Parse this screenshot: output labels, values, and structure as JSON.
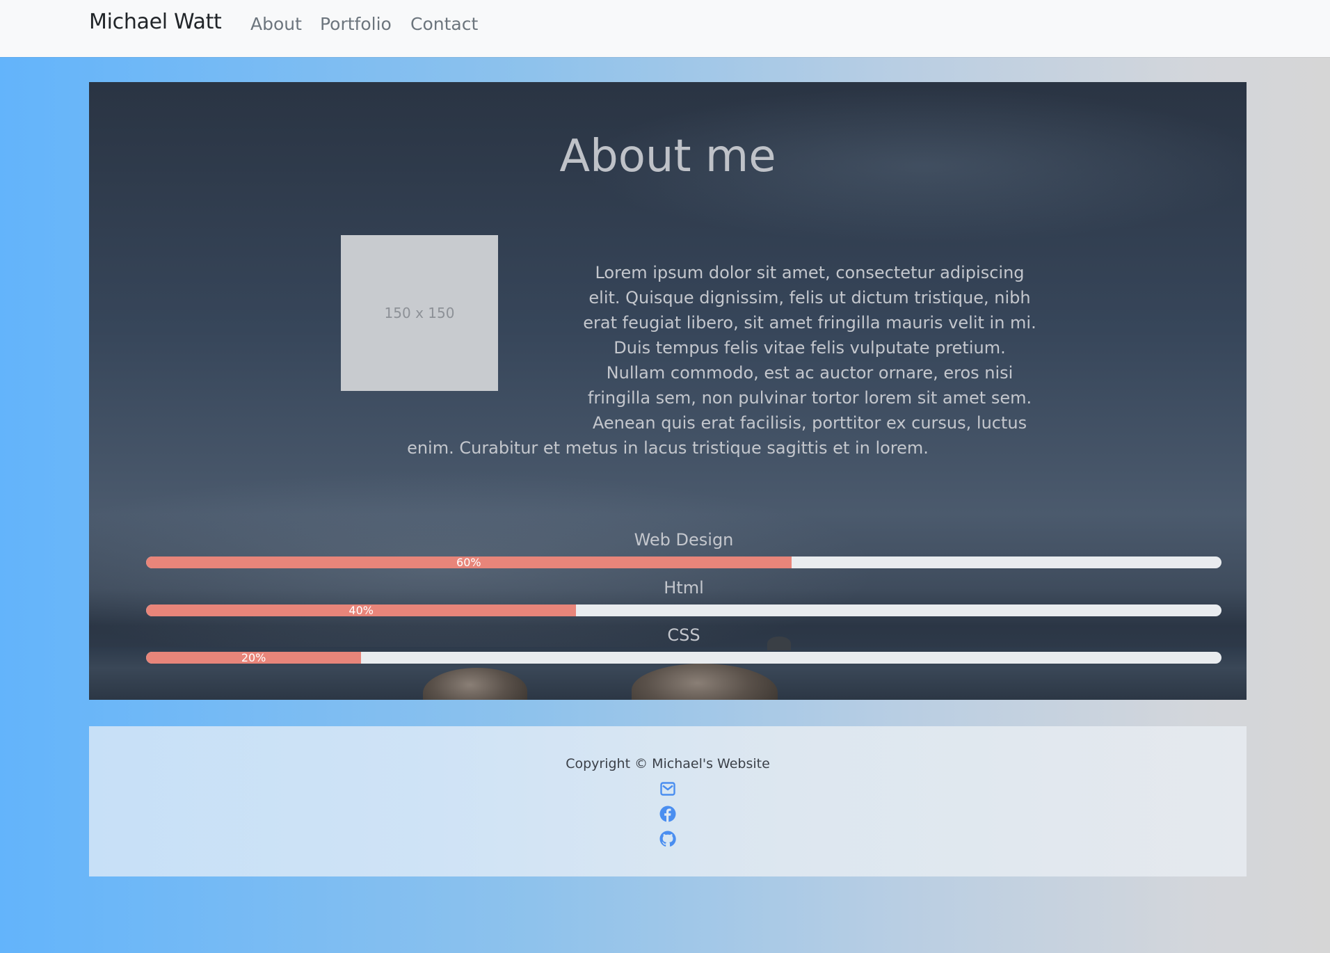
{
  "navbar": {
    "brand": "Michael Watt",
    "links": [
      {
        "label": "About"
      },
      {
        "label": "Portfolio"
      },
      {
        "label": "Contact"
      }
    ]
  },
  "hero": {
    "title": "About me",
    "image_placeholder": "150 x 150",
    "bio_lines": [
      "Lorem ipsum dolor sit amet, consectetur adipiscing",
      "elit. Quisque dignissim, felis ut dictum tristique, nibh",
      "erat feugiat libero, sit amet fringilla mauris velit in mi.",
      "Duis tempus felis vitae felis vulputate pretium.",
      "Nullam commodo, est ac auctor ornare, eros nisi",
      "fringilla sem, non pulvinar tortor lorem sit amet sem.",
      "Aenean quis erat facilisis, porttitor ex cursus, luctus",
      "enim. Curabitur et metus in lacus tristique sagittis et in lorem."
    ]
  },
  "skills": [
    {
      "name": "Web Design",
      "percent": 60,
      "percent_label": "60%"
    },
    {
      "name": "Html",
      "percent": 40,
      "percent_label": "40%"
    },
    {
      "name": "CSS",
      "percent": 20,
      "percent_label": "20%"
    }
  ],
  "footer": {
    "copyright": "Copyright © Michael's Website",
    "icons": [
      "envelope-icon",
      "facebook-icon",
      "github-icon"
    ]
  },
  "colors": {
    "progress_fill": "#e8857a",
    "progress_track": "#e9ecef",
    "footer_icon": "#4a8ef0"
  }
}
